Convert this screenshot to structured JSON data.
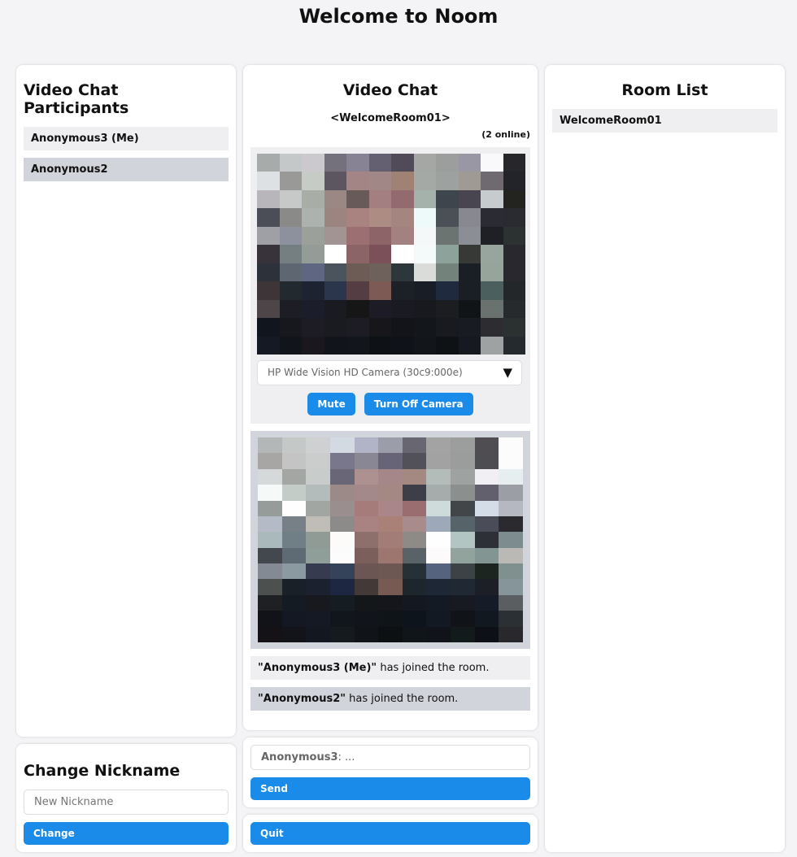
{
  "page_title": "Welcome to Noom",
  "participants": {
    "title": "Video Chat Participants",
    "items": [
      "Anonymous3 (Me)",
      "Anonymous2"
    ]
  },
  "nickname": {
    "title": "Change Nickname",
    "placeholder": "New Nickname",
    "button": "Change"
  },
  "video_chat": {
    "title": "Video Chat",
    "room": "<WelcomeRoom01>",
    "online": "(2 online)",
    "camera_select": "HP Wide Vision HD Camera (30c9:000e)",
    "mute_button": "Mute",
    "camera_button": "Turn Off Camera",
    "messages": [
      {
        "name": "\"Anonymous3 (Me)\"",
        "text": " has joined the room."
      },
      {
        "name": "\"Anonymous2\"",
        "text": " has joined the room."
      }
    ]
  },
  "send": {
    "prefix": "Anonymous3",
    "placeholder": ": ...",
    "button": "Send"
  },
  "quit_button": "Quit",
  "rooms": {
    "title": "Room List",
    "items": [
      "WelcomeRoom01"
    ]
  },
  "colors": {
    "accent": "#1a8be8",
    "item_light": "#efeff2",
    "item_dark": "#d2d4db"
  },
  "videos": {
    "my_video": [
      "#a7acab",
      "#c4c8c8",
      "#ccc9ce",
      "#74707c",
      "#878394",
      "#655f72",
      "#514b59",
      "#a5a7a5",
      "#9b9e9d",
      "#9997a3",
      "#f9f9fb",
      "#27262b",
      "#dde1e4",
      "#999a98",
      "#c7cbc6",
      "#5b5660",
      "#a38585",
      "#a18887",
      "#a08275",
      "#a4a9a5",
      "#9da19f",
      "#a09a95",
      "#6f6a70",
      "#23232a",
      "#b8b5bb",
      "#c6c9c8",
      "#a8ada6",
      "#9b8884",
      "#685a59",
      "#a37f81",
      "#936a70",
      "#a4b2ab",
      "#3f454d",
      "#484550",
      "#c6cbcd",
      "#23241f",
      "#4b4e57",
      "#8a8b88",
      "#acb2ad",
      "#9c8581",
      "#a8837f",
      "#ad8d83",
      "#a5857f",
      "#eef9f9",
      "#4b5056",
      "#878890",
      "#2b2c33",
      "#2a2b31",
      "#9fa0a5",
      "#8d919e",
      "#9ba09b",
      "#a19493",
      "#9c6f73",
      "#8d6468",
      "#a38180",
      "#f4f8f9",
      "#6c7472",
      "#8b8f95",
      "#1f2025",
      "#2c3131",
      "#38323a",
      "#757e80",
      "#959b97",
      "#ffffff",
      "#8a6466",
      "#7c5058",
      "#ffffff",
      "#f4f9f9",
      "#8ea29c",
      "#373937",
      "#97a59e",
      "#29282f",
      "#2c313a",
      "#5d6671",
      "#5e6681",
      "#4b545d",
      "#6d5c55",
      "#6e605a",
      "#2d363a",
      "#d9dcd8",
      "#74827c",
      "#1a1f26",
      "#96a49c",
      "#28282e",
      "#3d3537",
      "#222a30",
      "#1d2330",
      "#2b354c",
      "#543d43",
      "#7d5b54",
      "#1c2127",
      "#191d26",
      "#1f2a3f",
      "#1a1f26",
      "#4a5f5e",
      "#232729",
      "#4e4548",
      "#1c1d25",
      "#1c1d2a",
      "#1a1b20",
      "#161616",
      "#1d1b25",
      "#1a1a22",
      "#17191e",
      "#1b1d20",
      "#101416",
      "#6a7270",
      "#272a2c",
      "#11151d",
      "#16181e",
      "#1d1c25",
      "#1a1b21",
      "#1d1c25",
      "#16161b",
      "#13141a",
      "#13161b",
      "#181a1f",
      "#181b22",
      "#2c2c31",
      "#2b3030",
      "#151923",
      "#12141b",
      "#1a171f",
      "#11141b",
      "#13151c",
      "#0e1116",
      "#0f1319",
      "#12151a",
      "#0e1215",
      "#161920",
      "#9ea2a2",
      "#242a2d"
    ],
    "peer_video": [
      "#b3b7b7",
      "#c4c9c7",
      "#cfd0d2",
      "#d4dae2",
      "#b1b3c6",
      "#9b9ea8",
      "#686670",
      "#a3a3a3",
      "#9b9e9c",
      "#4f4d52",
      "#fdfcfd",
      "#a7a6a4",
      "#c4c4c4",
      "#cbcdcd",
      "#79778c",
      "#8a8795",
      "#676478",
      "#525059",
      "#a3a2a2",
      "#9b9d9c",
      "#4e4d51",
      "#fcfcfc",
      "#d5d9d9",
      "#a3a6a3",
      "#c8cdcc",
      "#696677",
      "#ac9190",
      "#a5878a",
      "#a48983",
      "#b4bcba",
      "#9ea3a2",
      "#f1eff4",
      "#e7eef0",
      "#f5faf9",
      "#c3ccc7",
      "#b3bcba",
      "#9c8a88",
      "#a4898a",
      "#a48884",
      "#3d3e47",
      "#a5acab",
      "#8b908f",
      "#61606c",
      "#9c9ea5",
      "#969c99",
      "#fefefe",
      "#a1a6a2",
      "#9a8f8e",
      "#a67c7b",
      "#a9868a",
      "#9a6e71",
      "#cfdadb",
      "#434649",
      "#d3dce7",
      "#b5b8c0",
      "#b5bac7",
      "#777f87",
      "#c0bdb7",
      "#8d8b8a",
      "#a98282",
      "#a98177",
      "#a78b8d",
      "#9da9b9",
      "#566369",
      "#4a4c58",
      "#2b2b2f",
      "#aab9bc",
      "#707e86",
      "#919b96",
      "#fdfafa",
      "#8d6f6c",
      "#a27c77",
      "#8d8a87",
      "#fefefe",
      "#b3c5c2",
      "#2e3038",
      "#7d8c8e",
      "#43474e",
      "#5e6b74",
      "#8f9e99",
      "#fcfcfc",
      "#7b5f5b",
      "#9d766f",
      "#596367",
      "#fdfafc",
      "#92a29c",
      "#839593",
      "#bab9b5",
      "#848a94",
      "#8b9aa1",
      "#373b4f",
      "#34435a",
      "#6b5654",
      "#6d5854",
      "#253037",
      "#55637e",
      "#3b4346",
      "#1c2520",
      "#7f908f",
      "#4c514f",
      "#192027",
      "#1c2130",
      "#1d2741",
      "#433a37",
      "#775a52",
      "#1d252d",
      "#1e2736",
      "#202933",
      "#1d1f26",
      "#86959a",
      "#1e2024",
      "#151b22",
      "#18191e",
      "#151d22",
      "#14171a",
      "#15161b",
      "#141820",
      "#131a24",
      "#181a21",
      "#151c28",
      "#5a5e61",
      "#111319",
      "#131822",
      "#141923",
      "#11161d",
      "#11141b",
      "#0f1419",
      "#0d141c",
      "#131922",
      "#101318",
      "#121820",
      "#2b3035",
      "#141216",
      "#13141a",
      "#131820",
      "#141a1e",
      "#101317",
      "#0d1013",
      "#10151a",
      "#101319",
      "#121a1b",
      "#0d1117",
      "#29282c"
    ]
  }
}
